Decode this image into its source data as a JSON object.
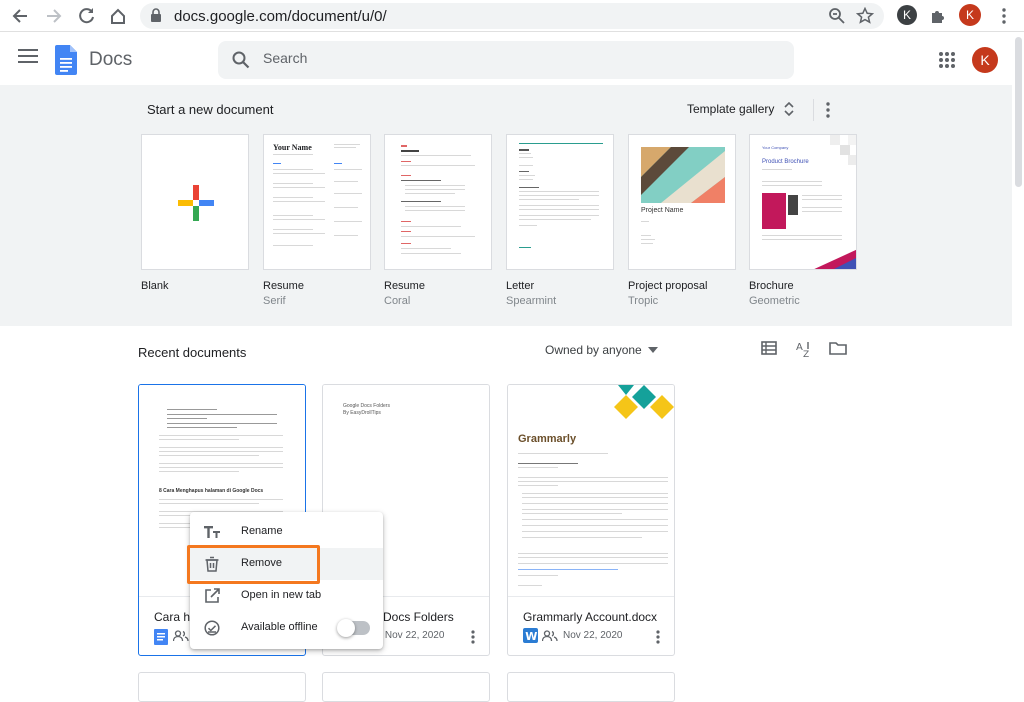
{
  "browser": {
    "url": "docs.google.com/document/u/0/",
    "avatar_letter": "K",
    "profile_letter": "K"
  },
  "header": {
    "app_title": "Docs",
    "search_placeholder": "Search",
    "account_letter": "K"
  },
  "templates": {
    "heading": "Start a new document",
    "gallery_label": "Template gallery",
    "items": [
      {
        "name": "Blank",
        "sub": ""
      },
      {
        "name": "Resume",
        "sub": "Serif",
        "preview_title": "Your Name"
      },
      {
        "name": "Resume",
        "sub": "Coral"
      },
      {
        "name": "Letter",
        "sub": "Spearmint"
      },
      {
        "name": "Project proposal",
        "sub": "Tropic",
        "preview_title": "Project Name"
      },
      {
        "name": "Brochure",
        "sub": "Geometric",
        "preview_company": "Your Company",
        "preview_title": "Product Brochure"
      }
    ]
  },
  "recent": {
    "heading": "Recent documents",
    "owner_filter": "Owned by anyone",
    "docs": [
      {
        "name": "Cara ha",
        "date": "",
        "preview_heading": "8 Cara Menghapus halaman di Google Docs"
      },
      {
        "name": "Docs Folders",
        "date": "ed Nov 22, 2020",
        "preview_title": "Google Docs Folders",
        "preview_sub": "By EasyDrollTips"
      },
      {
        "name": "Grammarly Account.docx",
        "date": "Nov 22, 2020",
        "preview_title": "Grammarly"
      }
    ]
  },
  "context_menu": {
    "items": [
      {
        "label": "Rename",
        "icon": "text-format-icon"
      },
      {
        "label": "Remove",
        "icon": "trash-icon"
      },
      {
        "label": "Open in new tab",
        "icon": "open-external-icon"
      },
      {
        "label": "Available offline",
        "icon": "offline-check-icon"
      }
    ]
  },
  "colors": {
    "accent_blue": "#1a73e8",
    "highlight_orange": "#f4781f",
    "avatar_red": "#c5391c"
  }
}
